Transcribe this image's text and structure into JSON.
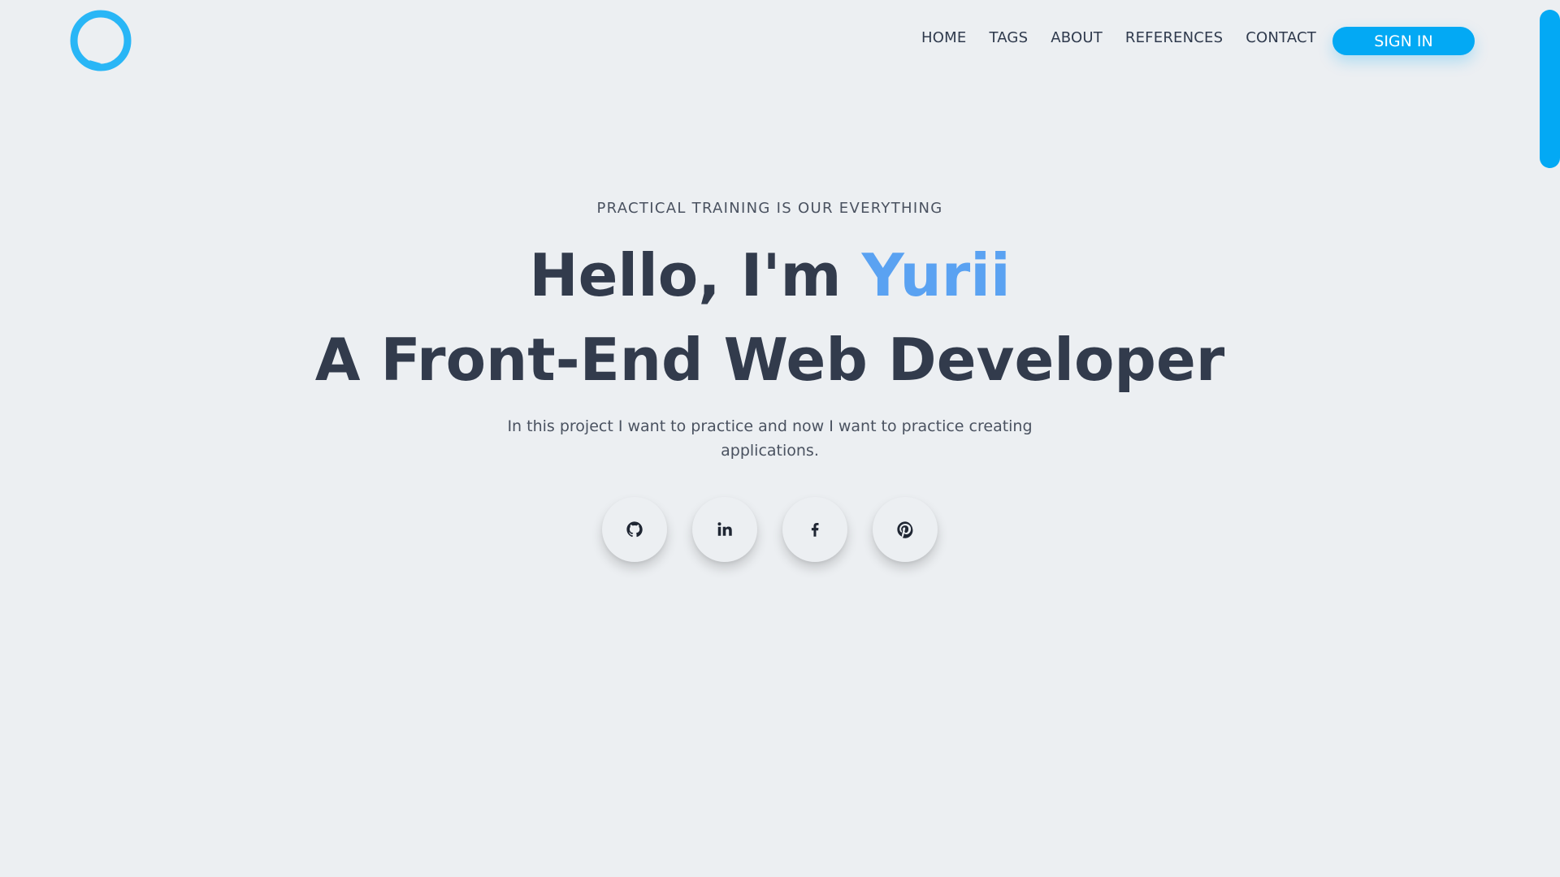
{
  "colors": {
    "background": "#eceff2",
    "accent": "#03a9f4",
    "name_highlight": "#5aa2f2",
    "heading": "#323b4c",
    "body_text": "#4a5260"
  },
  "header": {
    "logo_icon": "speech-bubble-ring-icon",
    "nav": [
      {
        "label": "HOME"
      },
      {
        "label": "TAGS"
      },
      {
        "label": "ABOUT"
      },
      {
        "label": "REFERENCES"
      },
      {
        "label": "CONTACT"
      }
    ],
    "signin_label": "SIGN IN"
  },
  "hero": {
    "eyebrow": "PRACTICAL TRAINING IS OUR EVERYTHING",
    "greeting": "Hello, I'm ",
    "name": "Yurii",
    "title": "A Front-End Web Developer",
    "description": "In this project I want to practice and now I want to practice creating applications."
  },
  "socials": [
    {
      "icon": "github-icon"
    },
    {
      "icon": "linkedin-icon"
    },
    {
      "icon": "facebook-icon"
    },
    {
      "icon": "pinterest-icon"
    }
  ]
}
